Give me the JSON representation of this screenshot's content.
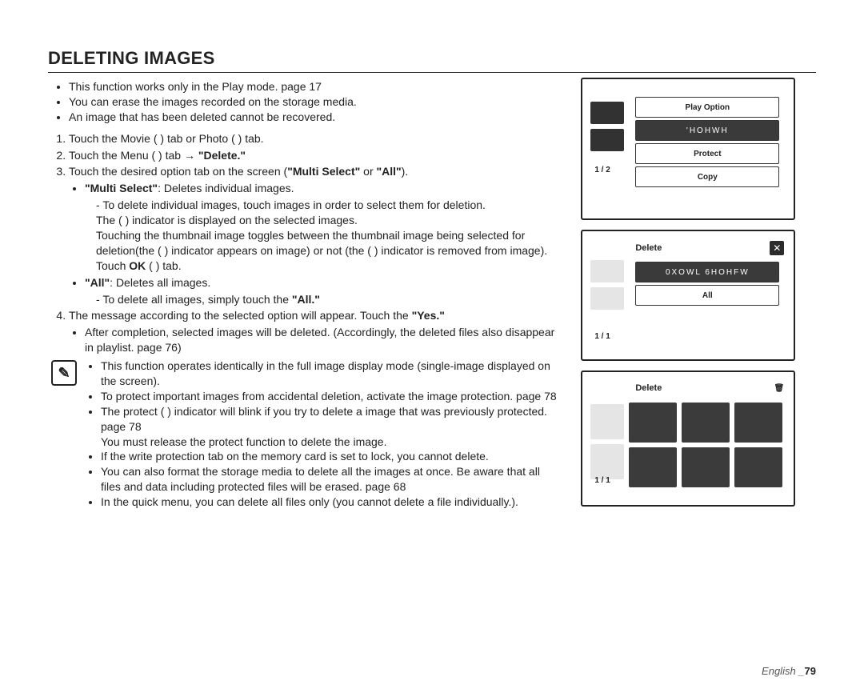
{
  "title": "DELETING IMAGES",
  "intro_bullets": [
    "This function works only in the Play mode.    page 17",
    "You can erase the images recorded on the storage media.",
    "An image that has been deleted cannot be recovered."
  ],
  "steps": {
    "s1": "Touch the Movie (     ) tab or Photo (     ) tab.",
    "s2_a": "Touch the Menu (     ) tab  ",
    "s2_b": "\"Delete.\"",
    "s3_a": "Touch the desired option tab on the screen (",
    "s3_b": "\"Multi Select\"",
    "s3_c": " or ",
    "s3_d": "\"All\"",
    "s3_e": ").",
    "s3_sub_ms_a": "\"Multi Select\"",
    "s3_sub_ms_b": ": Deletes individual images.",
    "s3_dash1": "To delete individual images, touch images in order to select them for deletion.",
    "s3_dash1b": "The (   ) indicator is displayed on the selected images.",
    "s3_dash1c_a": "Touching the thumbnail image toggles between the thumbnail image being selected for deletion(the (    ) indicator appears on image) or not (the (    ) indicator is removed from image). Touch ",
    "s3_dash1c_b": "OK",
    "s3_dash1c_c": " (     ) tab.",
    "s3_sub_all_a": "\"All\"",
    "s3_sub_all_b": ": Deletes all images.",
    "s3_dash2_a": "To delete all images, simply touch the ",
    "s3_dash2_b": "\"All.\"",
    "s4_a": "The message according to the selected option will appear. Touch the ",
    "s4_b": "\"Yes.\"",
    "s4_sub": "After completion, selected images will be deleted. (Accordingly, the deleted files also disappear in playlist.    page 76)"
  },
  "note_icon_label": "✎",
  "notes": [
    "This function operates identically in the full image display mode (single-image displayed on the screen).",
    "To protect important images from accidental deletion, activate the image protection.    page 78",
    "The protect (   ) indicator will blink if you try to delete a image that was previously protected.    page 78\nYou must release the protect function to delete the image.",
    "If the write protection tab on the memory card is set to lock, you cannot delete.",
    "You can also format the storage media to delete all the images at once. Be aware that all files and data including protected files will be erased.    page 68",
    "In the quick menu, you can delete all files only (you cannot delete a file individually.)."
  ],
  "footer_a": "English _",
  "footer_b": "79",
  "screens": {
    "s1": {
      "page": "1 / 2",
      "items": [
        "Play Option",
        "'HOHWH",
        "Protect",
        "Copy"
      ]
    },
    "s2": {
      "page": "1 / 1",
      "title": "Delete",
      "close": "✕",
      "items": [
        "0XOWL 6HOHFW",
        "All"
      ]
    },
    "s3": {
      "page": "1 / 1",
      "title": "Delete",
      "icon": "🗑"
    }
  }
}
